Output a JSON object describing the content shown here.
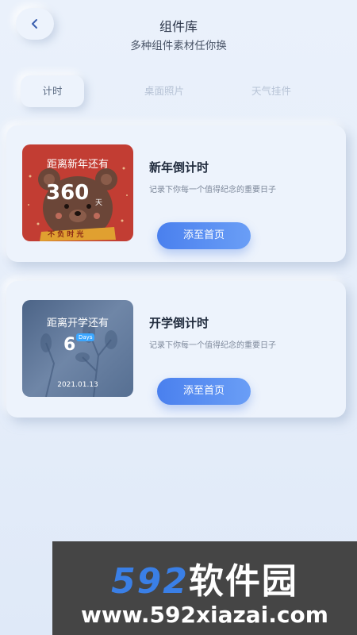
{
  "header": {
    "title": "组件库",
    "subtitle": "多种组件素材任你换",
    "back_icon": "chevron-left-icon"
  },
  "tabs": [
    {
      "label": "计时",
      "active": true
    },
    {
      "label": "桌面照片",
      "active": false
    },
    {
      "label": "天气挂件",
      "active": false
    }
  ],
  "cards": [
    {
      "title": "新年倒计时",
      "description": "记录下你每一个值得纪念的重要日子",
      "button_label": "添至首页",
      "thumb": {
        "caption": "距离新年还有",
        "number": "360",
        "unit": "天",
        "banner": "不 负 时 光",
        "bg_color": "#c23d33"
      }
    },
    {
      "title": "开学倒计时",
      "description": "记录下你每一个值得纪念的重要日子",
      "button_label": "添至首页",
      "thumb": {
        "caption": "距离开学还有",
        "number": "6",
        "badge": "Days",
        "date": "2021.01.13",
        "bg_color": "#566f92"
      }
    }
  ],
  "watermark": {
    "brand_number": "592",
    "brand_text": "软件园",
    "url": "www.592xiazai.com"
  },
  "colors": {
    "accent": "#4a80ee",
    "background": "#e6eefa"
  }
}
